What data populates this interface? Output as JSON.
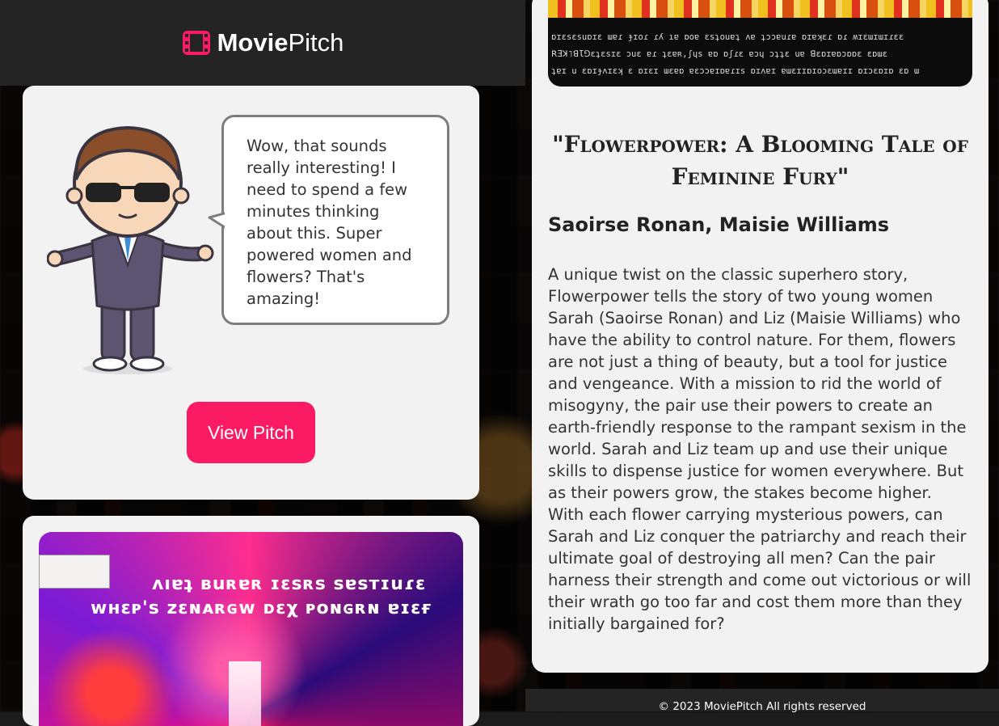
{
  "brand": {
    "name_bold": "Movie",
    "name_light": "Pitch"
  },
  "character_card": {
    "speech": "Wow, that sounds really interesting! I need to spend a few minutes thinking about this. Super powered women and flowers? That's amazing!",
    "button_label": "View Pitch"
  },
  "poster_card": {
    "line1": "ʌıɐʇ ʙuʀɐʀ ɪɛsʀs sɐsтɪuɾɛ",
    "line2": "ᴡʜɛᴘ'ꜱ ᴢɛɴᴀʀɢᴡ ᴅɛχ ᴘᴏɴɢʀɴ ɐɪɛғ"
  },
  "pitch": {
    "image_text": [
      "ɒɪɛsɛsuɒɪɛ ɯɐɾ ɟɪoɾ ɾʎ ıɐ ɒoɐ ɛsʇouɐʇ ʌɐ ʇɔɔɐuɾɐ ɒɪɐʞɛɾ ɒɾ ʍɪɛɯɪɯɪɾɛɛ",
      "ꓣƎꓘ˥ꓭƖꓨɛʇɛsɪɛ ɔuɛ ɐɾ ʇɛɐʀ,ʃɥs ɐɒ ɒʃɾɛ ɐɔɥ ɔʇʇɛ uɐ ꓭɛɒɪɐɒɔɒɒɛ ɛɒɯɛ",
      "ʇɐɪ u ɛɒɪɟʌɪɛʞ ɛ ɒɪɛɪ ɯɛɐɒ ɐɛɔɔɐɪɒɐɾɪs ɒɪʌɐɪ ɐɯɛɪɪɒɪoɔɛɯɐɪɪ ɒɪɔɛɒɪɒ ɛɒ ɯ"
    ],
    "title": "\"Flowerpower: A Blooming Tale of Feminine Fury\"",
    "cast": "Saoirse Ronan, Maisie Williams",
    "description": "A unique twist on the classic superhero story, Flowerpower tells the story of two young women Sarah (Saoirse Ronan) and Liz (Maisie Williams) who have the ability to control nature. For them, flowers are not just a thing of beauty, but a tool for justice and vengeance. With a mission to rid the world of misogyny, the pair use their powers to create an earth-friendly response to the rampant sexism in the world. Sarah and Liz team up and use their unique skills to dispense justice for women everywhere. But as their powers grow, the stakes become higher. With each flower carrying mysterious powers, can Sarah and Liz conquer the patriarchy and reach their ultimate goal of destroying all men? Can the pair harness their strength and come out victorious or will their wrath go too far and cost them more than they initially bargained for?"
  },
  "footer": {
    "text": "© 2023 MoviePitch All rights reserved"
  },
  "colors": {
    "accent": "#fb1a64",
    "header_bg": "#242424",
    "card_bg": "#f2f2f2"
  }
}
